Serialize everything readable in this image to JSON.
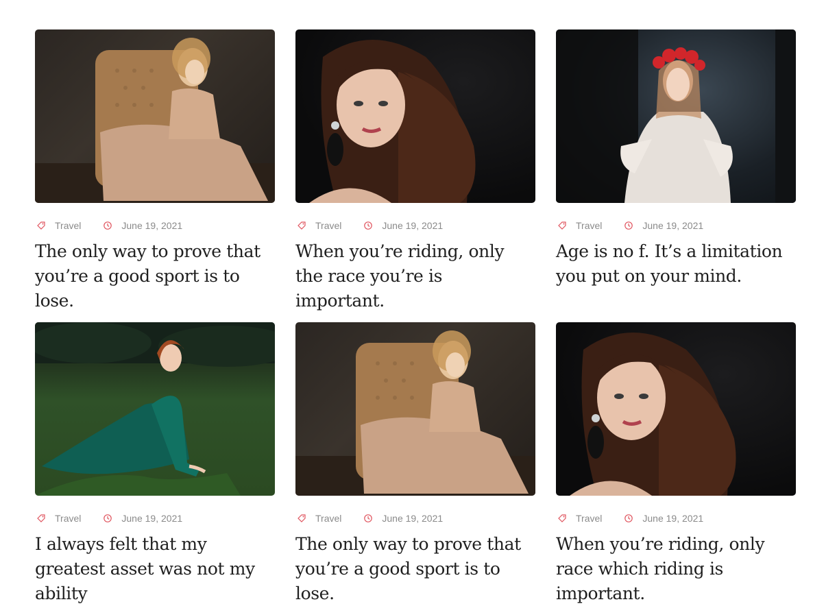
{
  "cards": [
    {
      "category": "Travel",
      "date": "June 19, 2021",
      "title": "The only way to prove that you’re a good sport is to lose.",
      "image": "woman-in-armchair-photo"
    },
    {
      "category": "Travel",
      "date": "June 19, 2021",
      "title": "When you’re riding, only the race you’re is important.",
      "image": "woman-curly-hair-photo"
    },
    {
      "category": "Travel",
      "date": "June 19, 2021",
      "title": "Age is no f. It’s a limitation you put on your mind.",
      "image": "woman-flower-crown-photo"
    },
    {
      "category": "Travel",
      "date": "June 19, 2021",
      "title": "I always felt that my greatest asset was not my ability",
      "image": "woman-on-grass-photo"
    },
    {
      "category": "Travel",
      "date": "June 19, 2021",
      "title": "The only way to prove that you’re a good sport is to lose.",
      "image": "woman-in-armchair-photo"
    },
    {
      "category": "Travel",
      "date": "June 19, 2021",
      "title": "When you’re riding, only race which riding is important.",
      "image": "woman-curly-hair-photo"
    }
  ],
  "colors": {
    "accent": "#e0555f",
    "meta_text": "#8a8a8a",
    "title_text": "#1f1f1f"
  },
  "icons": {
    "category": "tag-icon",
    "date": "clock-icon"
  }
}
